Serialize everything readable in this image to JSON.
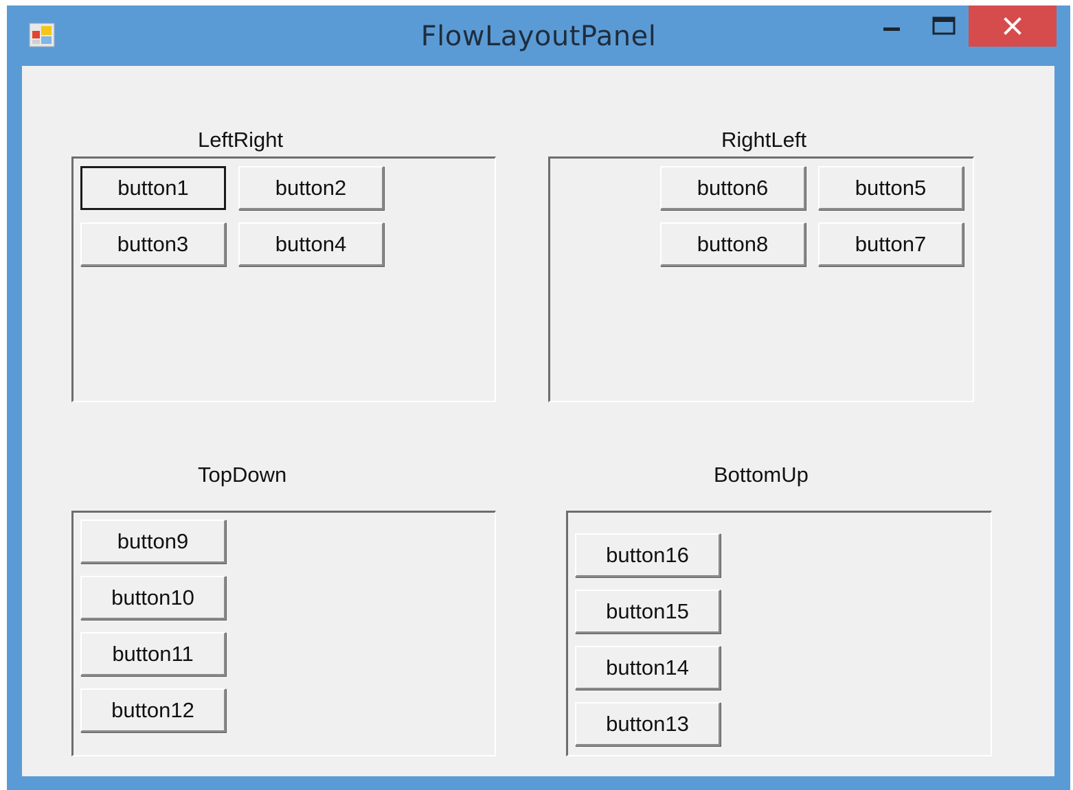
{
  "window": {
    "title": "FlowLayoutPanel",
    "controls": {
      "minimize_icon": "minimize-icon",
      "maximize_icon": "maximize-icon",
      "close_icon": "close-icon"
    },
    "colors": {
      "frame": "#5b9bd5",
      "close": "#d64c4c",
      "client": "#f0f0f0"
    }
  },
  "panels": {
    "left_right": {
      "label": "LeftRight",
      "buttons": [
        "button1",
        "button2",
        "button3",
        "button4"
      ]
    },
    "right_left": {
      "label": "RightLeft",
      "buttons": [
        "button6",
        "button5",
        "button8",
        "button7"
      ]
    },
    "top_down": {
      "label": "TopDown",
      "buttons": [
        "button9",
        "button10",
        "button11",
        "button12"
      ]
    },
    "bottom_up": {
      "label": "BottomUp",
      "buttons": [
        "button16",
        "button15",
        "button14",
        "button13"
      ]
    }
  }
}
